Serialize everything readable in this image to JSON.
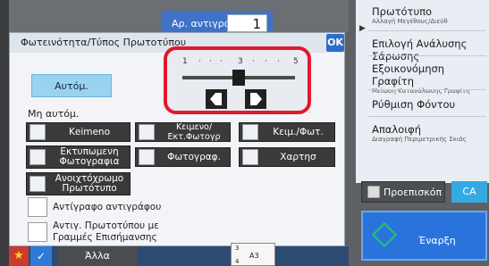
{
  "header": {
    "copies_label": "Αρ. αντιγράφων",
    "copies_value": "1"
  },
  "right_menu": [
    {
      "main": "Πρωτότυπο",
      "sub": "Αλλαγή Μεγέθους/Διεύθ"
    },
    {
      "main": "Επιλογή Ανάλυσης Σάρωσης",
      "sub": ""
    },
    {
      "main": "Εξοικονόμηση Γραφίτη",
      "sub": "Μείωση Κατανάλωσης Γραφίτη"
    },
    {
      "main": "Ρύθμιση Φόντου",
      "sub": ""
    },
    {
      "main": "Απαλοιφή",
      "sub": "Διαγραφή Περιμετρικής Σκιάς"
    }
  ],
  "dialog": {
    "title": "Φωτεινότητα/Τύπος Πρωτοτύπου",
    "ok_label": "OK",
    "auto_label": "Αυτόμ.",
    "manual_label": "Μη αυτόμ.",
    "type_buttons": [
      {
        "label": "Κeimeno",
        "icon": "document-icon"
      },
      {
        "label": "Κειμενο/Εκτ.Φωτογρ",
        "icon": "text-photo-icon"
      },
      {
        "label": "Κειμ./Φωτ.",
        "icon": "text-photo-icon"
      },
      {
        "label": "Εκτυπωμενη Φωτογραφια",
        "icon": "printed-photo-icon"
      },
      {
        "label": "Φωτογραφ.",
        "icon": "photo-icon"
      },
      {
        "label": "Χαρτησ",
        "icon": "map-icon"
      },
      {
        "label": "Ανοιχτόχρωμο Πρωτότυπο",
        "icon": "light-original-icon"
      }
    ],
    "checkboxes": [
      {
        "label": "Αντίγραφο αντιγράφου",
        "checked": false
      },
      {
        "label": "Αντιγ. Πρωτοτύπου με Γραμμές Επισήμανσης",
        "checked": false
      }
    ],
    "exposure": {
      "scale_labels": [
        "1",
        "3",
        "5"
      ],
      "value": 3,
      "min": 1,
      "max": 5
    }
  },
  "footer": {
    "other_label": "Άλλα",
    "tray_top": "3",
    "tray_size": "A3",
    "tray_bottom": "4"
  },
  "actions": {
    "preview_label": "Προεπισκόπ",
    "ca_label": "CA",
    "start_label": "Έναρξη"
  },
  "colors": {
    "accent": "#2f6cc9",
    "highlight": "#e0192f",
    "ca": "#33aae2"
  }
}
